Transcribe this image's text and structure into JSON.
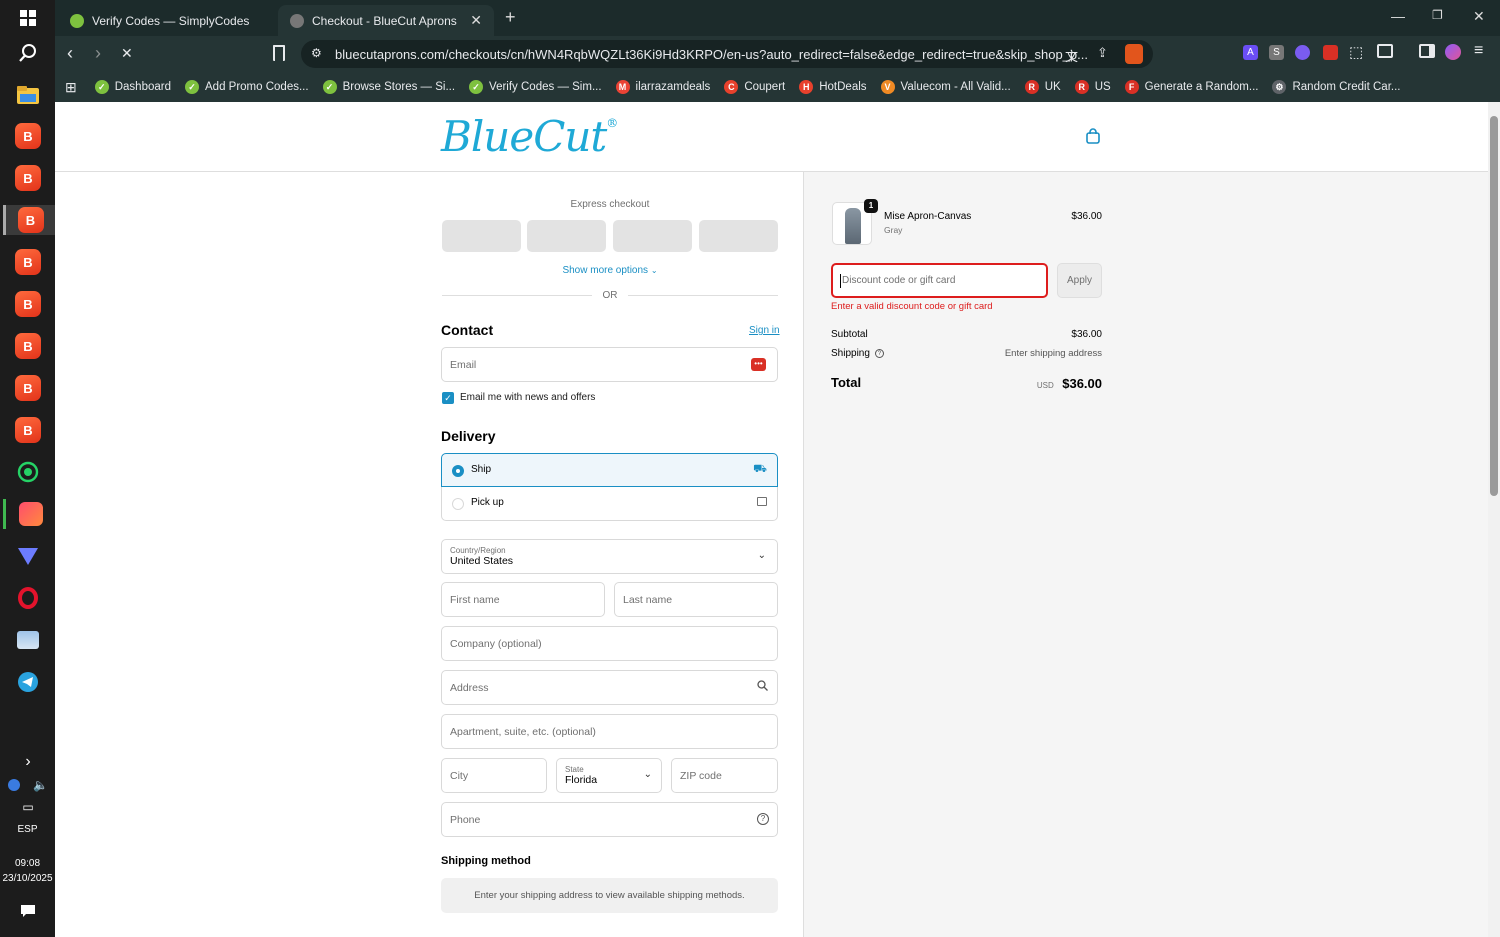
{
  "taskbar": {
    "lang": "ESP",
    "time": "09:08",
    "date": "23/10/2025"
  },
  "browser": {
    "tabs": [
      {
        "title": "Verify Codes — SimplyCodes",
        "active": false
      },
      {
        "title": "Checkout - BlueCut Aprons",
        "active": true
      }
    ],
    "url": "bluecutaprons.com/checkouts/cn/hWN4RqbWQZLt36Ki9Hd3KRPO/en-us?auto_redirect=false&edge_redirect=true&skip_shop_p...",
    "bookmarks": [
      {
        "label": "Dashboard",
        "color": "#7ec13f",
        "glyph": "✓"
      },
      {
        "label": "Add Promo Codes...",
        "color": "#7ec13f",
        "glyph": "✓"
      },
      {
        "label": "Browse Stores — Si...",
        "color": "#7ec13f",
        "glyph": "✓"
      },
      {
        "label": "Verify Codes — Sim...",
        "color": "#7ec13f",
        "glyph": "✓"
      },
      {
        "label": "ilarrazamdeals",
        "color": "#ea4335",
        "glyph": "M"
      },
      {
        "label": "Coupert",
        "color": "#e8412c",
        "glyph": "C"
      },
      {
        "label": "HotDeals",
        "color": "#e8412c",
        "glyph": "H"
      },
      {
        "label": "Valuecom - All Valid...",
        "color": "#f08a24",
        "glyph": "V"
      },
      {
        "label": "UK",
        "color": "#d93025",
        "glyph": "R"
      },
      {
        "label": "US",
        "color": "#d93025",
        "glyph": "R"
      },
      {
        "label": "Generate a Random...",
        "color": "#d93025",
        "glyph": "F"
      },
      {
        "label": "Random Credit Car...",
        "color": "#5f6368",
        "glyph": "⚙"
      }
    ]
  },
  "checkout": {
    "logo": "BlueCut",
    "express_title": "Express checkout",
    "show_more": "Show more options",
    "or": "OR",
    "contact_title": "Contact",
    "sign_in": "Sign in",
    "email_placeholder": "Email",
    "news_label": "Email me with news and offers",
    "delivery_title": "Delivery",
    "ship_label": "Ship",
    "pickup_label": "Pick up",
    "country_label": "Country/Region",
    "country_value": "United States",
    "first_name": "First name",
    "last_name": "Last name",
    "company": "Company (optional)",
    "address": "Address",
    "apartment": "Apartment, suite, etc. (optional)",
    "city": "City",
    "state_label": "State",
    "state_value": "Florida",
    "zip": "ZIP code",
    "phone": "Phone",
    "shipping_method_title": "Shipping method",
    "shipping_method_note": "Enter your shipping address to view available shipping methods."
  },
  "summary": {
    "item_name": "Mise Apron-Canvas",
    "item_variant": "Gray",
    "item_qty": "1",
    "item_price": "$36.00",
    "discount_placeholder": "Discount code or gift card",
    "apply": "Apply",
    "discount_error": "Enter a valid discount code or gift card",
    "subtotal_label": "Subtotal",
    "subtotal_value": "$36.00",
    "shipping_label": "Shipping",
    "shipping_value": "Enter shipping address",
    "total_label": "Total",
    "currency": "USD",
    "total_value": "$36.00"
  },
  "colors": {
    "accent": "#1a8fc4",
    "error": "#dd1d1d",
    "brand": "#1fa9d6"
  }
}
